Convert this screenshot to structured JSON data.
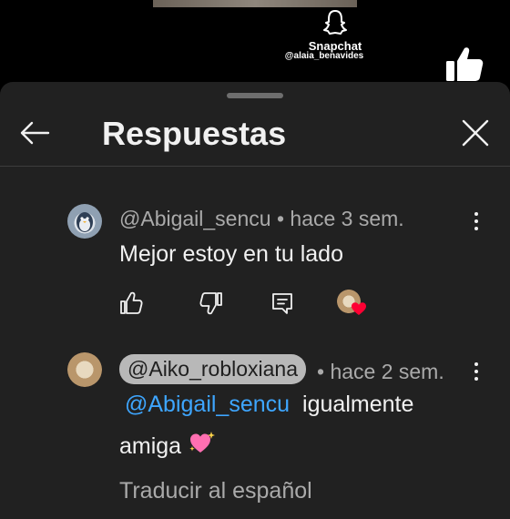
{
  "video": {
    "watermark_app": "Snapchat",
    "watermark_handle": "@alaia_benavides"
  },
  "sheet": {
    "title": "Respuestas"
  },
  "comments": [
    {
      "author": "@Abigail_sencu",
      "separator": "•",
      "time": "hace 3 sem.",
      "text": "Mejor estoy en tu lado"
    }
  ],
  "replies": [
    {
      "author": "@Aiko_robloxiana",
      "time": "• hace 2 sem.",
      "mention": "@Abigail_sencu",
      "text_line1": "igualmente",
      "text_line2": "amiga",
      "emoji": "sparkling-heart",
      "translate_label": "Traducir al español"
    }
  ],
  "icons": {
    "back": "arrow-left-icon",
    "close": "close-icon",
    "more": "more-vertical-icon",
    "like": "thumbs-up-icon",
    "dislike": "thumbs-down-icon",
    "reply": "comment-icon"
  },
  "colors": {
    "sheet_bg": "#212121",
    "mention_link": "#3ea6ff",
    "chip_bg": "#b8b8b8",
    "heart": "#ff0033"
  }
}
